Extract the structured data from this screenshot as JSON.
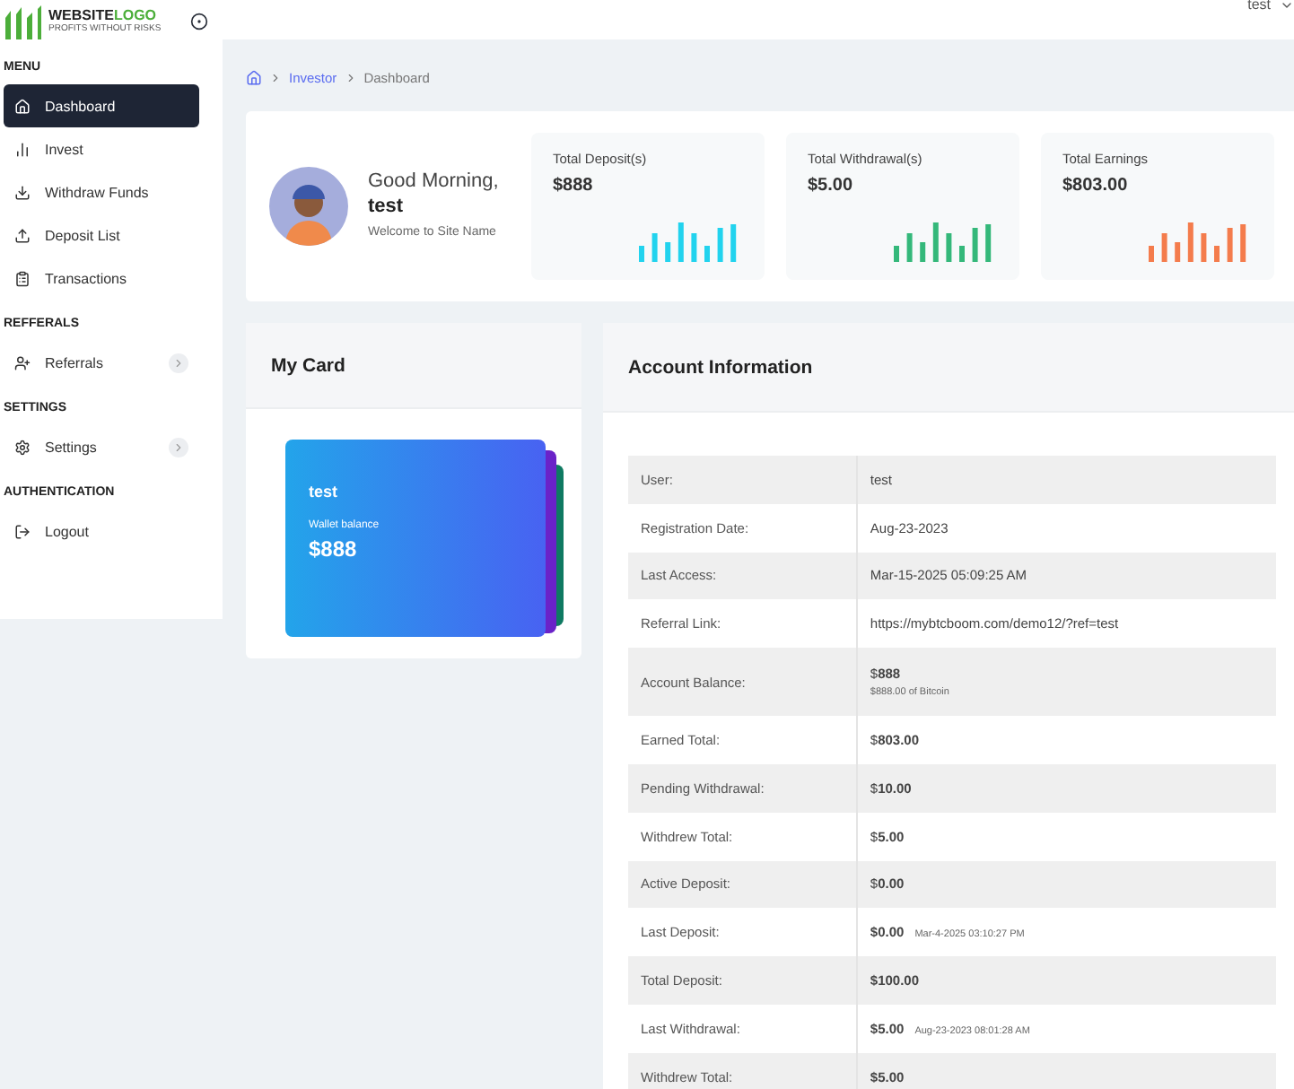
{
  "logo": {
    "name": "WEBSITE",
    "accent": "LOGO",
    "tagline": "PROFITS WITHOUT RISKS"
  },
  "header": {
    "user": "test"
  },
  "sidebar": [
    {
      "heading": "MENU",
      "items": [
        {
          "label": "Dashboard",
          "selected": true,
          "submenu": false
        },
        {
          "label": "Invest",
          "selected": false,
          "submenu": false
        },
        {
          "label": "Withdraw Funds",
          "selected": false,
          "submenu": false
        },
        {
          "label": "Deposit List",
          "selected": false,
          "submenu": false
        },
        {
          "label": "Transactions",
          "selected": false,
          "submenu": false
        }
      ]
    },
    {
      "heading": "REFFERALS",
      "items": [
        {
          "label": "Referrals",
          "selected": false,
          "submenu": true
        }
      ]
    },
    {
      "heading": "SETTINGS",
      "items": [
        {
          "label": "Settings",
          "selected": false,
          "submenu": true
        }
      ]
    },
    {
      "heading": "AUTHENTICATION",
      "items": [
        {
          "label": "Logout",
          "selected": false,
          "submenu": false
        }
      ]
    }
  ],
  "breadcrumb": [
    "Investor",
    "Dashboard"
  ],
  "welcome": {
    "greeting": "Good Morning,",
    "name": "test",
    "subtitle": "Welcome to Site Name"
  },
  "stats": [
    {
      "title": "Total Deposit(s)",
      "value": "$888",
      "color": "#22d3ee"
    },
    {
      "title": "Total Withdrawal(s)",
      "value": "$5.00",
      "color": "#34b87a"
    },
    {
      "title": "Total Earnings",
      "value": "$803.00",
      "color": "#f47c4c"
    }
  ],
  "my_card": {
    "title": "My Card",
    "holder": "test",
    "balance_label": "Wallet balance",
    "balance": "$888"
  },
  "account": {
    "title": "Account Information",
    "rows": [
      {
        "label": "User:",
        "value": "test"
      },
      {
        "label": "Registration Date:",
        "value": "Aug-23-2023"
      },
      {
        "label": "Last Access:",
        "value": "Mar-15-2025 05:09:25 AM"
      },
      {
        "label": "Referral Link:",
        "value": "https://mybtcboom.com/demo12/?ref=test"
      },
      {
        "label": "Account Balance:",
        "value": "$**888**",
        "note": "$888.00 of Bitcoin"
      },
      {
        "label": "Earned Total:",
        "value": "$**803.00**"
      },
      {
        "label": "Pending Withdrawal:",
        "value": "$**10.00**"
      },
      {
        "label": "Withdrew Total:",
        "value": "$**5.00**"
      },
      {
        "label": "Active Deposit:",
        "value": "$**0.00**"
      },
      {
        "label": "Last Deposit:",
        "value": "**$0.00**",
        "date": "Mar-4-2025 03:10:27 PM"
      },
      {
        "label": "Total Deposit:",
        "value": "**$100.00**"
      },
      {
        "label": "Last Withdrawal:",
        "value": "**$5.00**",
        "date": "Aug-23-2023 08:01:28 AM"
      },
      {
        "label": "Withdrew Total:",
        "value": "**$5.00**"
      }
    ]
  }
}
